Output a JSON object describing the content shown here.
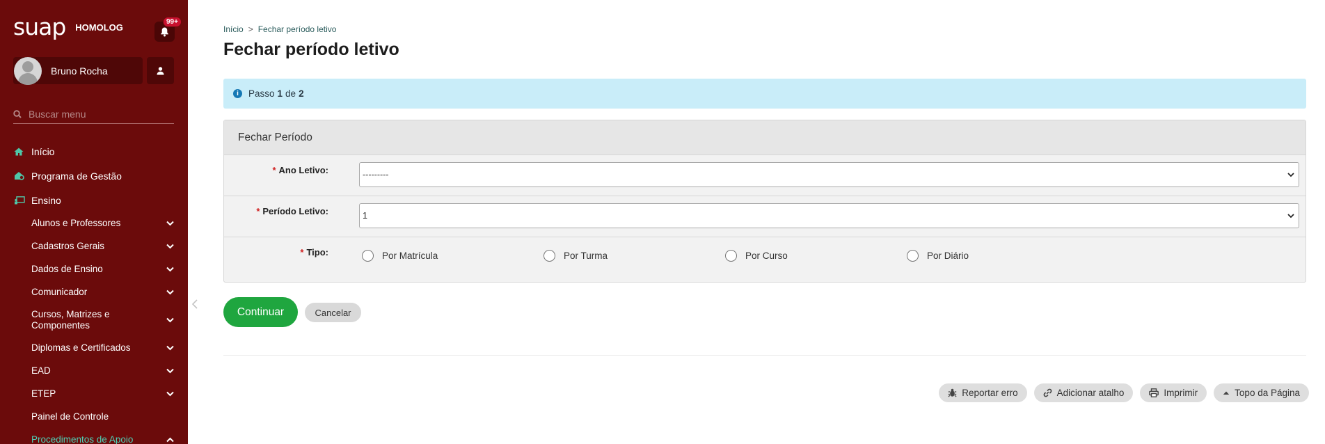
{
  "app": {
    "logo": "suap",
    "environment": "HOMOLOG",
    "notification_count": "99+"
  },
  "user": {
    "name": "Bruno Rocha"
  },
  "search": {
    "placeholder": "Buscar menu"
  },
  "menu": {
    "top_items": [
      {
        "label": "Início",
        "icon": "home-icon"
      },
      {
        "label": "Programa de Gestão",
        "icon": "gestao-icon"
      },
      {
        "label": "Ensino",
        "icon": "ensino-icon"
      }
    ],
    "sub_items": [
      {
        "label": "Alunos e Professores",
        "chevron": "down"
      },
      {
        "label": "Cadastros Gerais",
        "chevron": "down"
      },
      {
        "label": "Dados de Ensino",
        "chevron": "down"
      },
      {
        "label": "Comunicador",
        "chevron": "down"
      },
      {
        "label": "Cursos, Matrizes e Componentes",
        "chevron": "down"
      },
      {
        "label": "Diplomas e Certificados",
        "chevron": "down"
      },
      {
        "label": "EAD",
        "chevron": "down"
      },
      {
        "label": "ETEP",
        "chevron": "down"
      },
      {
        "label": "Painel de Controle",
        "chevron": ""
      },
      {
        "label": "Procedimentos de Apoio",
        "chevron": "up"
      }
    ]
  },
  "breadcrumb": {
    "home": "Início",
    "separator": ">",
    "current": "Fechar período letivo"
  },
  "page": {
    "title": "Fechar período letivo"
  },
  "alert": {
    "prefix": "Passo",
    "step": "1",
    "of": "de",
    "total": "2"
  },
  "form": {
    "title": "Fechar Período",
    "required_mark": "*",
    "ano_letivo": {
      "label": "Ano Letivo:",
      "value": "---------"
    },
    "periodo_letivo": {
      "label": "Período Letivo:",
      "value": "1"
    },
    "tipo": {
      "label": "Tipo:",
      "options": [
        "Por Matrícula",
        "Por Turma",
        "Por Curso",
        "Por Diário"
      ]
    }
  },
  "actions": {
    "continue": "Continuar",
    "cancel": "Cancelar"
  },
  "footer": {
    "report": "Reportar erro",
    "shortcut": "Adicionar atalho",
    "print": "Imprimir",
    "top": "Topo da Página"
  },
  "colors": {
    "sidebar": "#6b0b0b",
    "primary_button": "#1fa63f",
    "alert_bg": "#c9edf9",
    "active_menu": "#4fd1b6"
  }
}
